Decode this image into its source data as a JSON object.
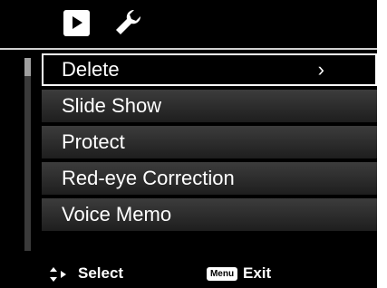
{
  "header": {
    "tabs": [
      {
        "icon": "playback-icon",
        "selected": true
      },
      {
        "icon": "wrench-icon",
        "selected": false
      }
    ]
  },
  "menu": {
    "items": [
      {
        "label": "Delete",
        "selected": true,
        "has_submenu": true,
        "submenu_arrow": "›"
      },
      {
        "label": "Slide Show",
        "selected": false
      },
      {
        "label": "Protect",
        "selected": false
      },
      {
        "label": "Red-eye Correction",
        "selected": false
      },
      {
        "label": "Voice Memo",
        "selected": false
      }
    ],
    "scroll_position_fraction": 0
  },
  "footer": {
    "select_icon": "up-down-right-arrows-icon",
    "select_label": "Select",
    "menu_badge": "Menu",
    "exit_label": "Exit"
  },
  "colors": {
    "background": "#000000",
    "text": "#ffffff",
    "highlight_border": "#ffffff",
    "item_gradient_top": "#3c3c3c",
    "item_gradient_bottom": "#1e1e1e"
  }
}
